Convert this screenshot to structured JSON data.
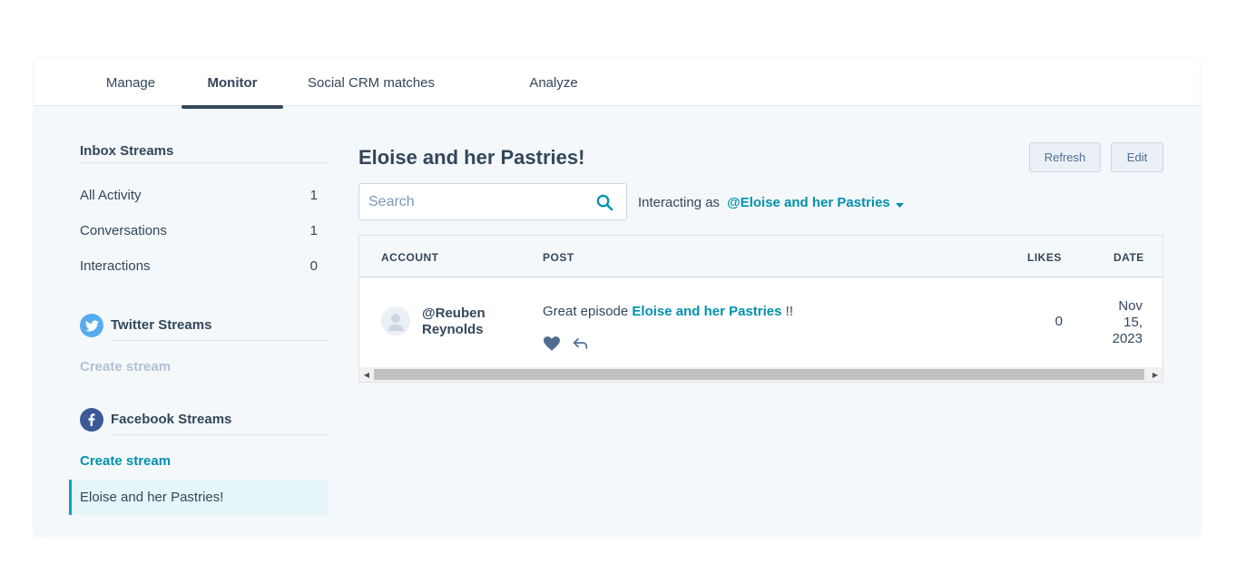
{
  "tabs": [
    {
      "label": "Manage"
    },
    {
      "label": "Monitor"
    },
    {
      "label": "Social CRM matches"
    },
    {
      "label": "Analyze"
    }
  ],
  "sidebar": {
    "inbox_title": "Inbox Streams",
    "inbox_items": [
      {
        "label": "All Activity",
        "count": "1"
      },
      {
        "label": "Conversations",
        "count": "1"
      },
      {
        "label": "Interactions",
        "count": "0"
      }
    ],
    "twitter_title": "Twitter Streams",
    "twitter_create": "Create stream",
    "facebook_title": "Facebook Streams",
    "facebook_create": "Create stream",
    "facebook_streams": [
      {
        "label": "Eloise and her Pastries!"
      }
    ]
  },
  "main": {
    "title": "Eloise and her Pastries!",
    "refresh_label": "Refresh",
    "edit_label": "Edit",
    "search_placeholder": "Search",
    "interacting_label": "Interacting as",
    "interacting_account": "@Eloise and her Pastries"
  },
  "table": {
    "headers": {
      "account": "ACCOUNT",
      "post": "POST",
      "likes": "LIKES",
      "date": "DATE"
    },
    "rows": [
      {
        "account_line1": "@Reuben",
        "account_line2": "Reynolds",
        "post_prefix": "Great episode ",
        "post_mention": "Eloise and her Pastries",
        "post_suffix": " !!",
        "likes": "0",
        "date_line1": "Nov",
        "date_line2": "15,",
        "date_line3": "2023"
      }
    ]
  },
  "colors": {
    "accent": "#0091ae",
    "text": "#33475b",
    "twitter": "#55acee",
    "facebook": "#3b5998",
    "muted_link": "#b0c1d4",
    "active_stream_bg": "#e5f5f8"
  }
}
